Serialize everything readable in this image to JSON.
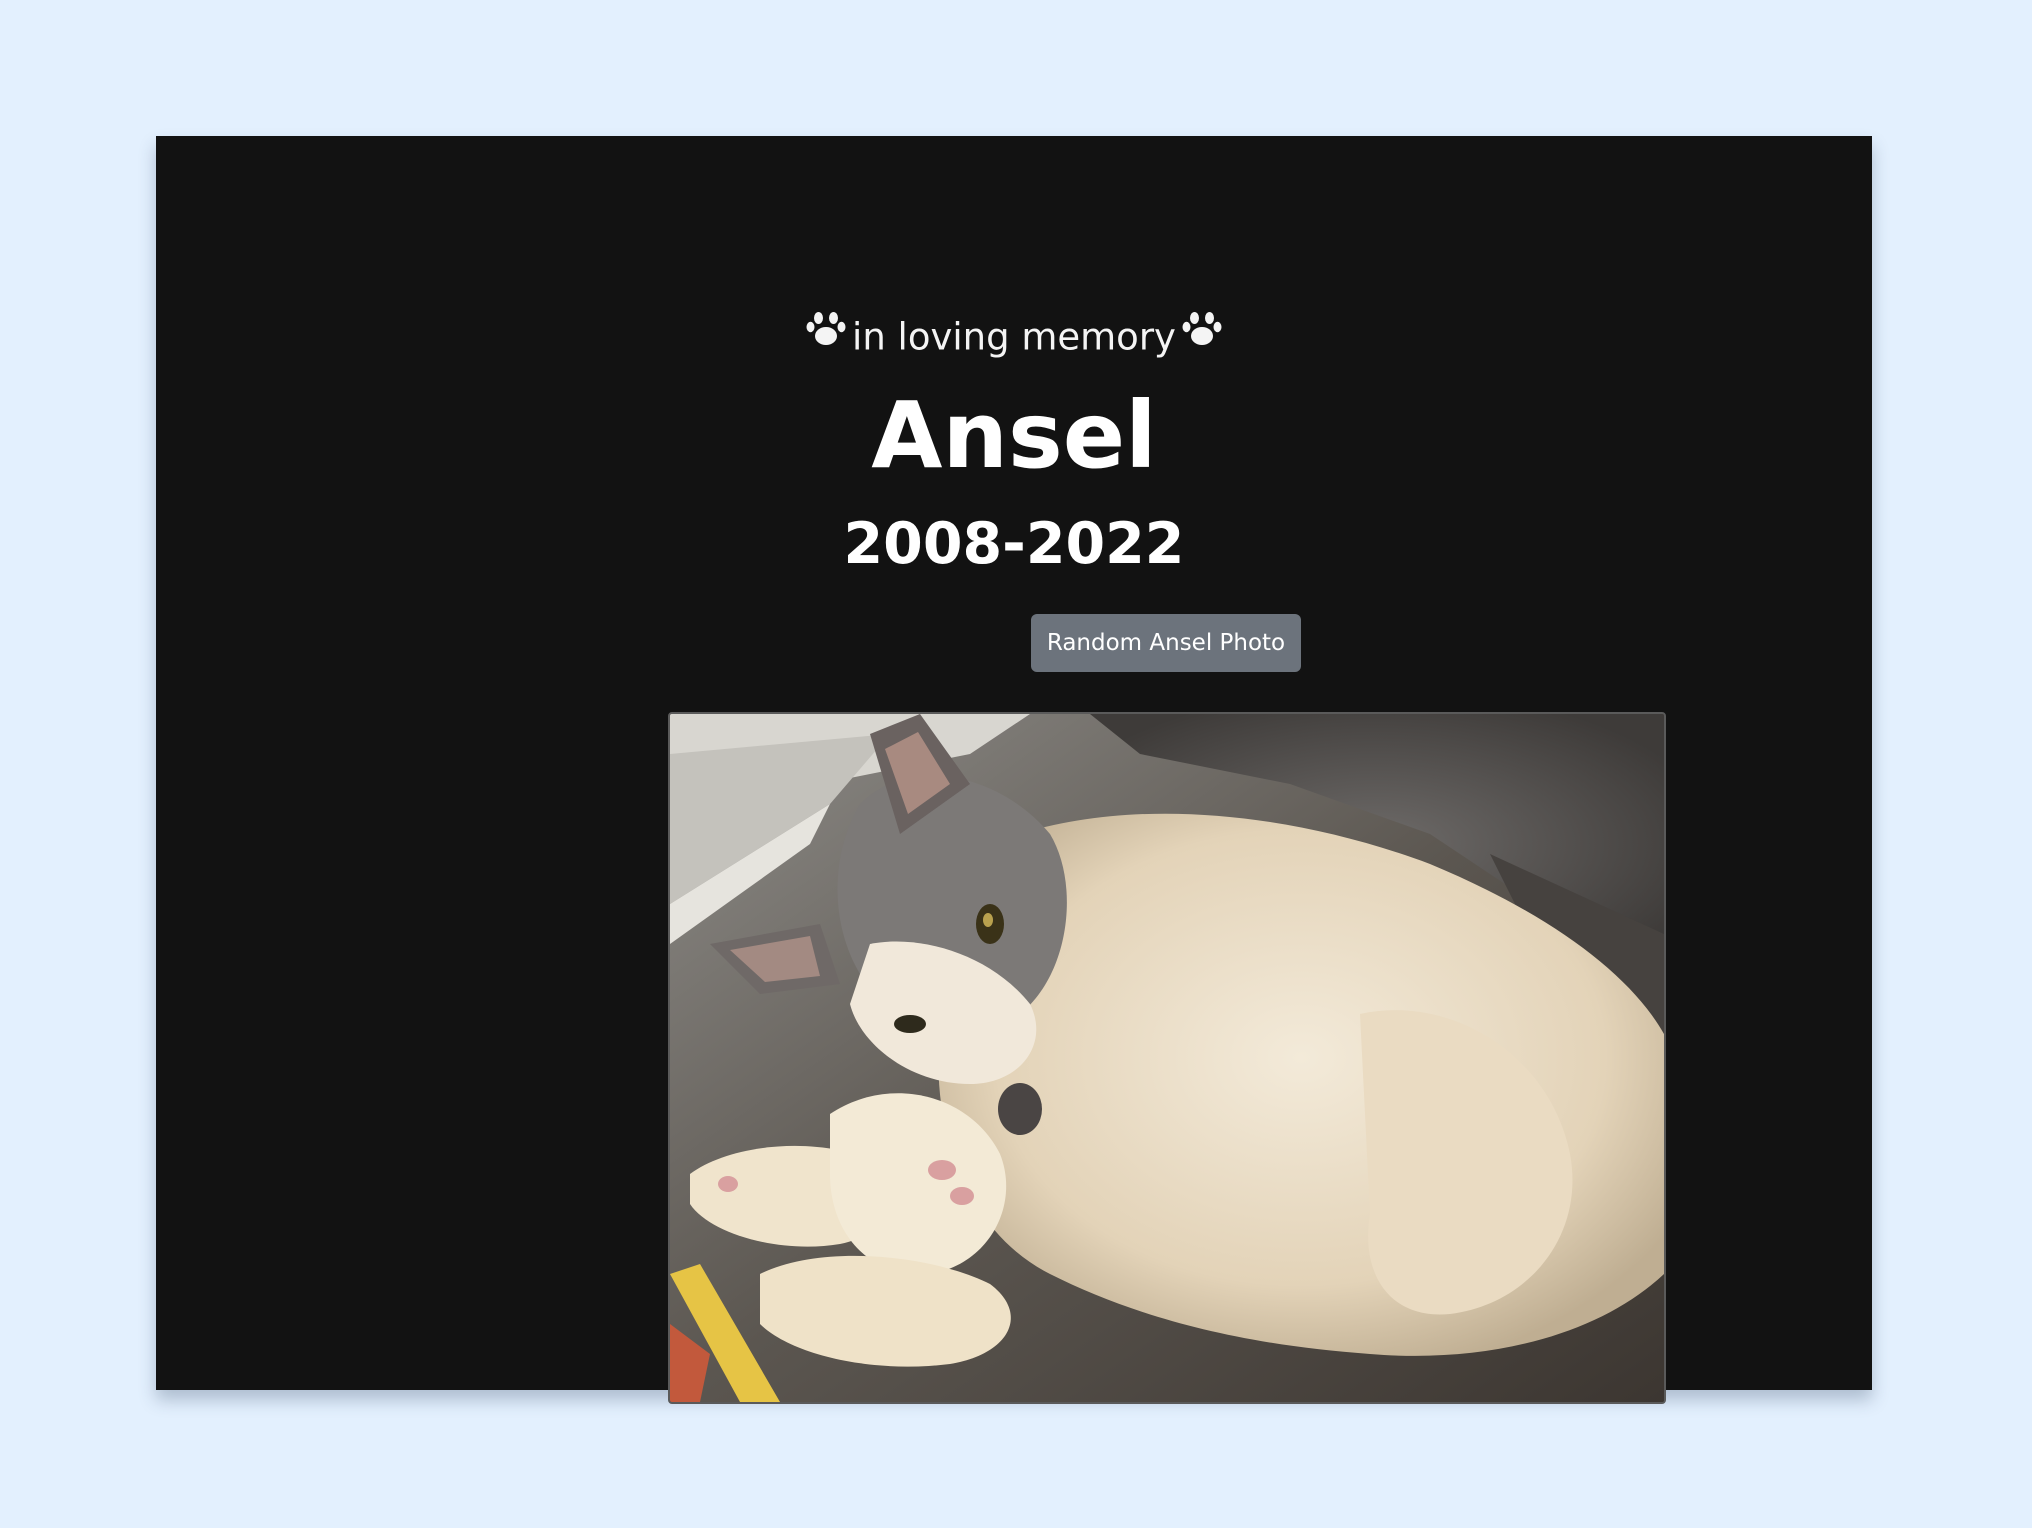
{
  "memorial": {
    "tagline": "in loving memory",
    "name": "Ansel",
    "years": "2008-2022",
    "random_button_label": "Random Ansel Photo",
    "left_icon": "paw-icon",
    "right_icon": "paw-icon"
  }
}
